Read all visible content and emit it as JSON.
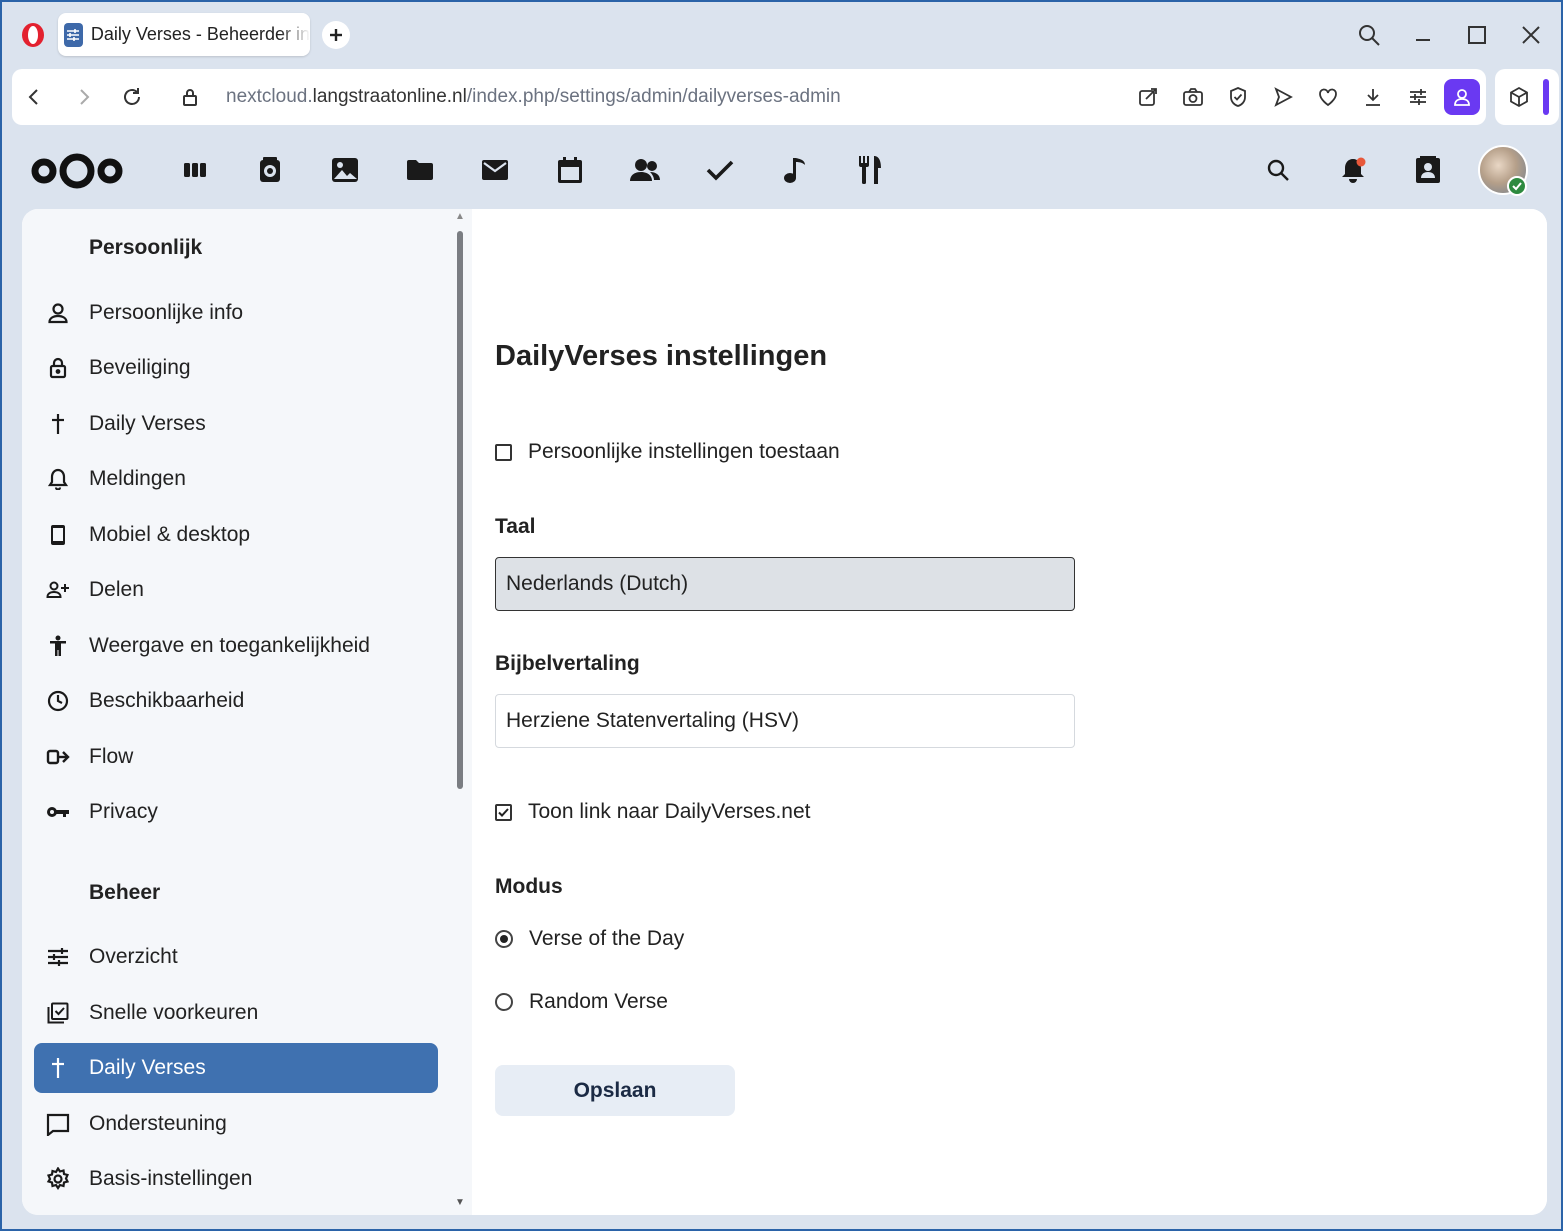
{
  "browser": {
    "tab_title": "Daily Verses - Beheerder in",
    "url_prefix": "nextcloud.",
    "url_host": "langstraatonline.nl",
    "url_path": "/index.php/settings/admin/dailyverses-admin"
  },
  "colors": {
    "accent": "#3f71b0",
    "browser_profile": "#6a39f2",
    "status_online": "#2d8a3f",
    "notification_dot": "#e8583a"
  },
  "header": {
    "apps": [
      "dashboard-icon",
      "memories-icon",
      "photos-icon",
      "files-icon",
      "mail-icon",
      "calendar-icon",
      "contacts-icon",
      "tasks-icon",
      "music-icon",
      "cookbook-icon"
    ]
  },
  "sidebar": {
    "personal_title": "Persoonlijk",
    "personal_items": [
      {
        "label": "Persoonlijke info",
        "icon": "user-icon"
      },
      {
        "label": "Beveiliging",
        "icon": "lock-icon"
      },
      {
        "label": "Daily Verses",
        "icon": "cross-icon"
      },
      {
        "label": "Meldingen",
        "icon": "bell-icon"
      },
      {
        "label": "Mobiel & desktop",
        "icon": "phone-icon"
      },
      {
        "label": "Delen",
        "icon": "share-user-icon"
      },
      {
        "label": "Weergave en toegankelijkheid",
        "icon": "accessibility-icon"
      },
      {
        "label": "Beschikbaarheid",
        "icon": "clock-icon"
      },
      {
        "label": "Flow",
        "icon": "flow-icon"
      },
      {
        "label": "Privacy",
        "icon": "key-icon"
      }
    ],
    "admin_title": "Beheer",
    "admin_items": [
      {
        "label": "Overzicht",
        "icon": "tune-icon"
      },
      {
        "label": "Snelle voorkeuren",
        "icon": "checklist-icon"
      },
      {
        "label": "Daily Verses",
        "icon": "cross-icon",
        "active": true
      },
      {
        "label": "Ondersteuning",
        "icon": "chat-icon"
      },
      {
        "label": "Basis-instellingen",
        "icon": "gear-icon"
      }
    ]
  },
  "main": {
    "title": "DailyVerses instellingen",
    "allow_personal_label": "Persoonlijke instellingen toestaan",
    "allow_personal_checked": false,
    "language_label": "Taal",
    "language_value": "Nederlands (Dutch)",
    "translation_label": "Bijbelvertaling",
    "translation_value": "Herziene Statenvertaling (HSV)",
    "show_link_label": "Toon link naar DailyVerses.net",
    "show_link_checked": true,
    "mode_label": "Modus",
    "mode_options": [
      "Verse of the Day",
      "Random Verse"
    ],
    "mode_selected": "Verse of the Day",
    "save_label": "Opslaan"
  }
}
